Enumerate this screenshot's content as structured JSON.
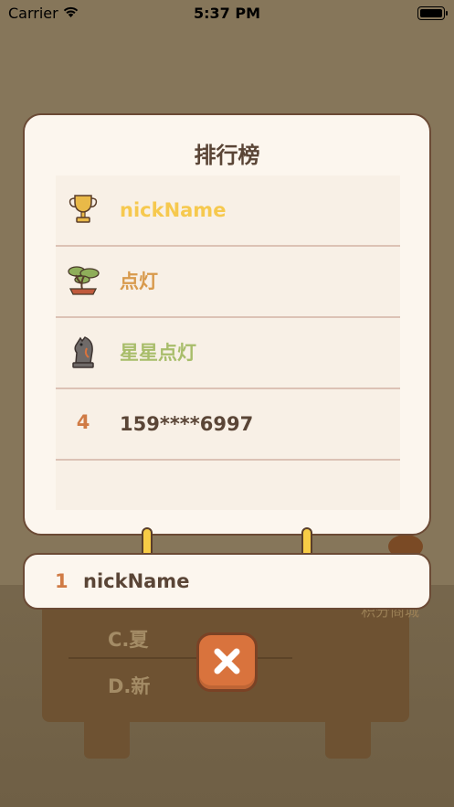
{
  "status_bar": {
    "carrier": "Carrier",
    "time": "5:37 PM"
  },
  "background": {
    "options": [
      "C.夏",
      "D.新"
    ],
    "faint_text": "积分商城"
  },
  "leaderboard": {
    "title": "排行榜",
    "entries": [
      {
        "rank": "1",
        "badge": "trophy",
        "name": "nickName",
        "color": "#f6c94f"
      },
      {
        "rank": "2",
        "badge": "bonsai",
        "name": "点灯",
        "color": "#d89a4c"
      },
      {
        "rank": "3",
        "badge": "chess-knight",
        "name": "星星点灯",
        "color": "#a8bd6a"
      },
      {
        "rank": "4",
        "badge": "",
        "name": "159****6997",
        "color": "#5a4536"
      }
    ]
  },
  "my_rank": {
    "rank": "1",
    "name": "nickName"
  },
  "close_button": {
    "icon": "close-icon",
    "color": "#d9733d"
  }
}
